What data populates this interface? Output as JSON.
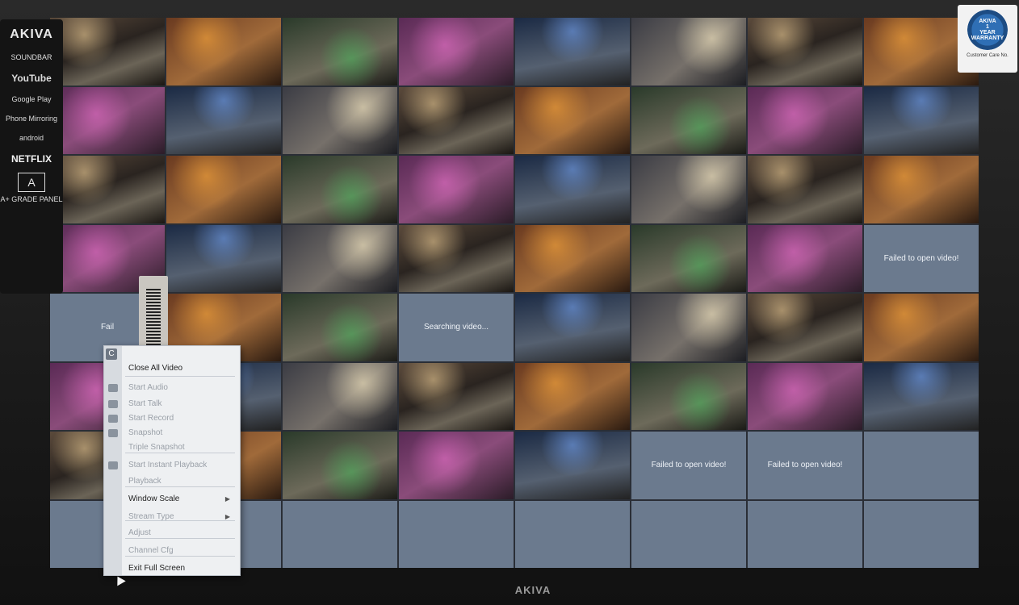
{
  "brand": {
    "monitor_logo": "AKIVA",
    "sticker_brand": "AKIVA",
    "sticker_items": [
      "SOUNDBAR",
      "YouTube",
      "Google Play",
      "Phone Mirroring",
      "android",
      "NETFLIX"
    ],
    "grade_letter": "A",
    "grade_label": "A+ GRADE PANEL",
    "warranty_brand": "AKIVA",
    "warranty_line1": "1",
    "warranty_line2": "YEAR",
    "warranty_line3": "WARRANTY",
    "warranty_support": "Customer Care No."
  },
  "grid": {
    "columns": 8,
    "rows": 8,
    "messages": {
      "failed": "Failed to open video!",
      "searching": "Searching video...",
      "failed_partial": "Fail"
    }
  },
  "context_menu": {
    "close_label": "C",
    "items": [
      {
        "label": "Close All Video",
        "enabled": true
      },
      {
        "label": "Start Audio",
        "enabled": false
      },
      {
        "label": "Start Talk",
        "enabled": false
      },
      {
        "label": "Start Record",
        "enabled": false
      },
      {
        "label": "Snapshot",
        "enabled": false
      },
      {
        "label": "Triple Snapshot",
        "enabled": false
      },
      {
        "label": "Start Instant Playback",
        "enabled": false
      },
      {
        "label": "Playback",
        "enabled": false
      },
      {
        "label": "Window Scale",
        "enabled": true,
        "submenu": true
      },
      {
        "label": "Stream Type",
        "enabled": false,
        "submenu": true
      },
      {
        "label": "Adjust",
        "enabled": false
      },
      {
        "label": "Channel Cfg",
        "enabled": false
      },
      {
        "label": "Exit Full Screen",
        "enabled": true
      }
    ]
  }
}
